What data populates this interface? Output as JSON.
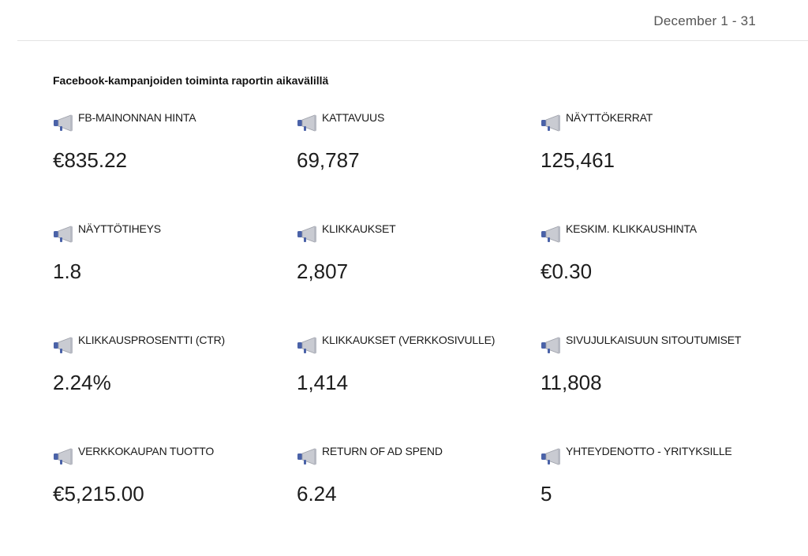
{
  "header": {
    "date_range": "December 1 - 31"
  },
  "section": {
    "title": "Facebook-kampanjoiden toiminta raportin aikavälillä"
  },
  "icon": "megaphone-icon",
  "colors": {
    "megaphone_body": "#c9cbd2",
    "megaphone_handle": "#4a62a8"
  },
  "metrics": [
    {
      "label": "FB-MAINONNAN HINTA",
      "value": "€835.22"
    },
    {
      "label": "KATTAVUUS",
      "value": "69,787"
    },
    {
      "label": "NÄYTTÖKERRAT",
      "value": "125,461"
    },
    {
      "label": "NÄYTTÖTIHEYS",
      "value": "1.8"
    },
    {
      "label": "KLIKKAUKSET",
      "value": "2,807"
    },
    {
      "label": "KESKIM. KLIKKAUSHINTA",
      "value": "€0.30"
    },
    {
      "label": "KLIKKAUSPROSENTTI (CTR)",
      "value": "2.24%"
    },
    {
      "label": "KLIKKAUKSET (VERKKOSIVULLE)",
      "value": "1,414"
    },
    {
      "label": "SIVUJULKAISUUN SITOUTUMISET",
      "value": "11,808"
    },
    {
      "label": "VERKKOKAUPAN TUOTTO",
      "value": "€5,215.00"
    },
    {
      "label": "RETURN OF AD SPEND",
      "value": "6.24"
    },
    {
      "label": "YHTEYDENOTTO - YRITYKSILLE",
      "value": "5"
    }
  ]
}
